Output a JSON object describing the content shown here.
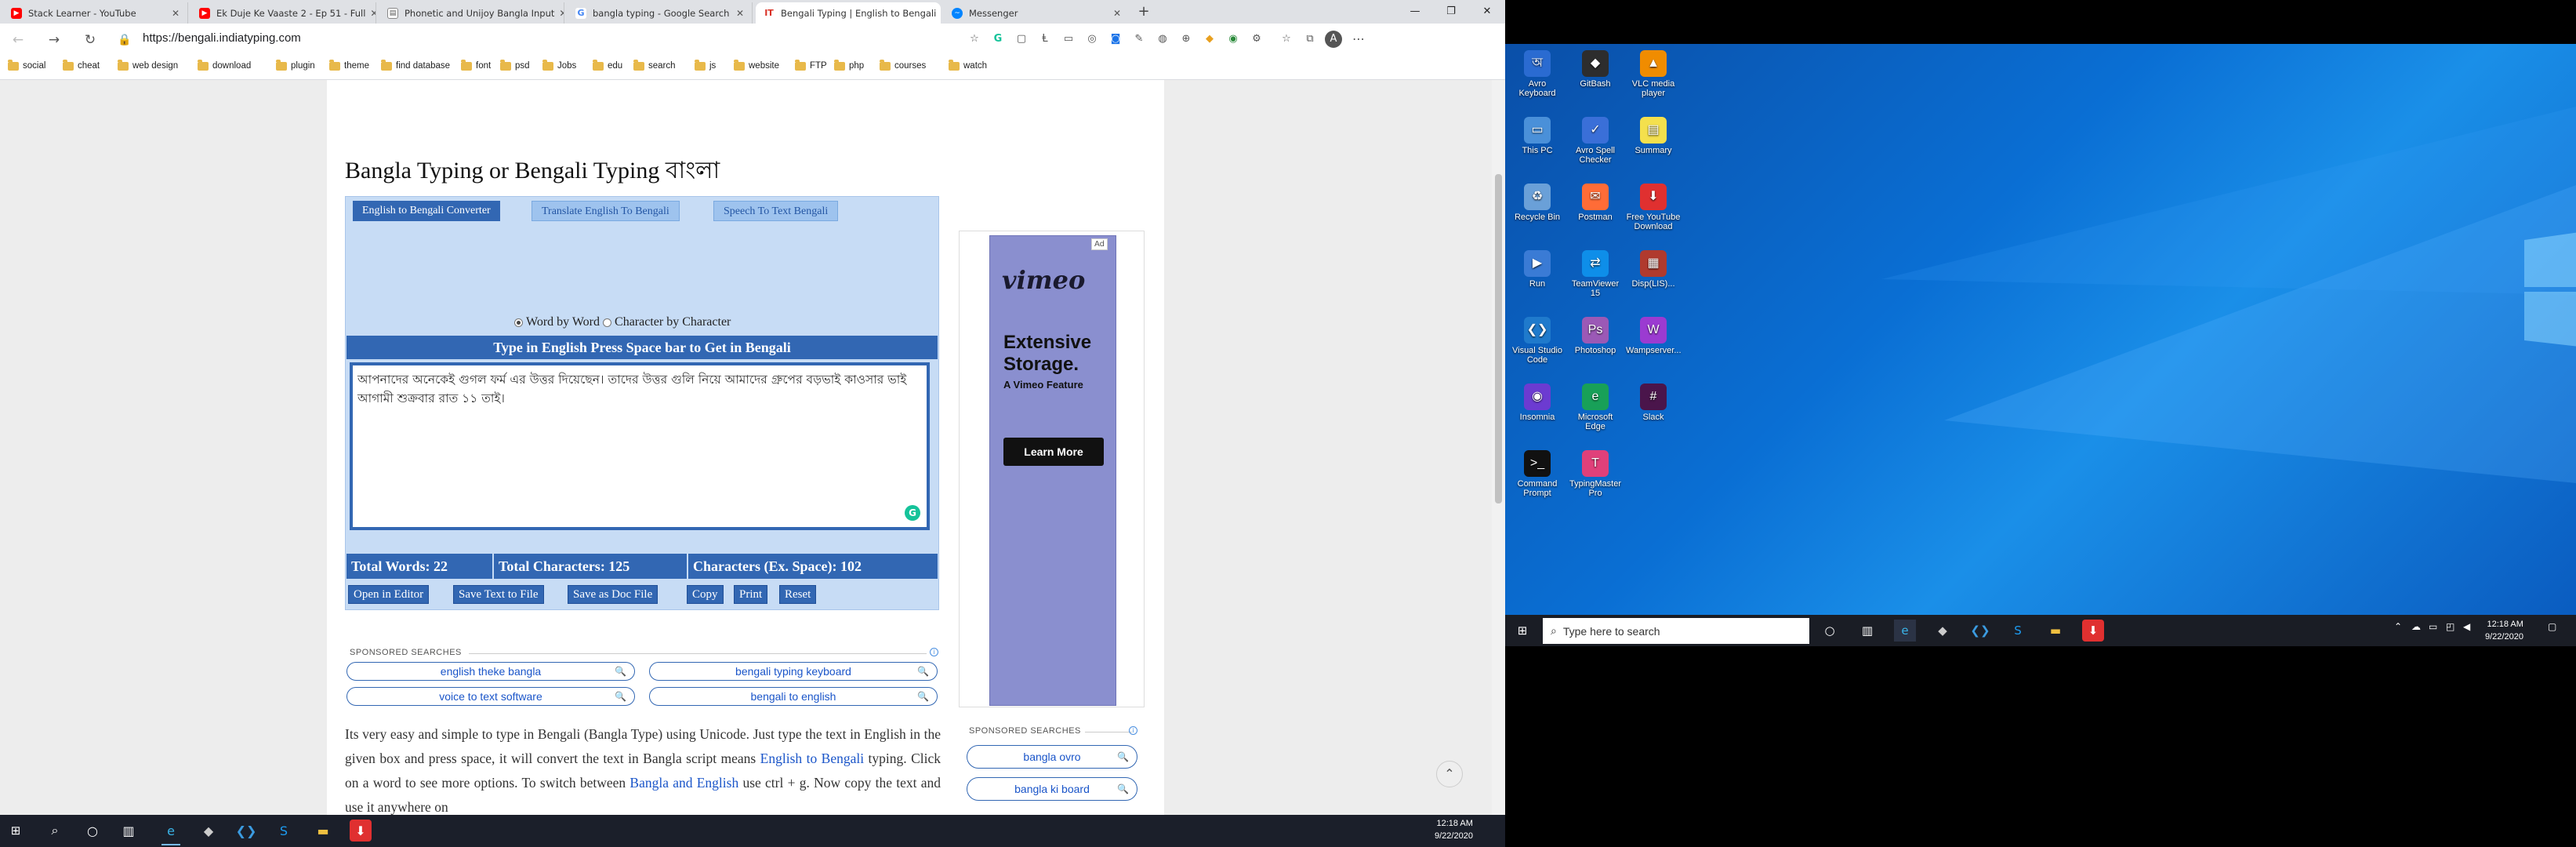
{
  "browser": {
    "tabs": [
      {
        "label": "Stack Learner - YouTube",
        "color": "#ff0000"
      },
      {
        "label": "Ek Duje Ke Vaaste 2 - Ep 51 - Full",
        "color": "#ff0000"
      },
      {
        "label": "Phonetic and Unijoy Bangla Input",
        "color": "#888888"
      },
      {
        "label": "bangla typing - Google Search",
        "color": "#4285f4"
      },
      {
        "label": "Bengali Typing | English to Bengali",
        "color": "#d93025"
      },
      {
        "label": "Messenger",
        "color": "#0084ff"
      }
    ],
    "url": "https://bengali.indiatyping.com",
    "bookmarks": [
      "social",
      "cheat",
      "web design",
      "download",
      "plugin",
      "theme",
      "find database",
      "font",
      "psd",
      "Jobs",
      "edu",
      "search",
      "js",
      "website",
      "FTP",
      "php",
      "courses",
      "watch"
    ]
  },
  "page": {
    "title": "Bangla Typing or Bengali Typing বাংলা",
    "tabs": [
      "English to Bengali Converter",
      "Translate English To Bengali",
      "Speech To Text Bengali"
    ],
    "mode": {
      "word": "Word by Word",
      "char": "Character by Character"
    },
    "instruction": "Type in English Press Space bar to Get in Bengali",
    "text": "আপনাদের অনেকেই গুগল ফর্ম এর উত্তর দিয়েছেন। তাদের উত্তর গুলি নিয়ে আমাদের গ্রুপের বড়ভাই কাওসার ভাই আগামী শুক্রবার রাত ১১ তাই।",
    "stats": {
      "words": "Total Words: 22",
      "chars": "Total Characters: 125",
      "chars_ex": "Characters (Ex. Space): 102"
    },
    "buttons": [
      "Open in Editor",
      "Save Text to File",
      "Save as Doc File",
      "Copy",
      "Print",
      "Reset"
    ],
    "sponsored_label": "SPONSORED SEARCHES",
    "sponsored": [
      "english theke bangla",
      "bengali typing keyboard",
      "voice to text software",
      "bengali to english"
    ],
    "side_sponsored": [
      "bangla ovro",
      "bangla ki board"
    ],
    "paragraph": {
      "p1": "Its very easy and simple to type in Bengali (Bangla Type) using Unicode. Just type the text in English in the given box and press space, it will convert the text in Bangla script means ",
      "link1": "English to Bengali",
      "p2": " typing. Click on a word to see more options. To switch between ",
      "link2": "Bangla and English",
      "p3": " use ctrl + g. Now copy the text and use it anywhere on"
    },
    "ad": {
      "tag": "Ad",
      "brand": "vimeo",
      "headline1": "Extensive",
      "headline2": "Storage.",
      "sub": "A Vimeo Feature",
      "cta": "Learn More"
    }
  },
  "taskbar_left": {
    "time": "12:18 AM",
    "date": "9/22/2020"
  },
  "desktop": {
    "icons": [
      {
        "label": "Avro Keyboard",
        "color": "#2a6bd1",
        "glyph": "অ"
      },
      {
        "label": "GitBash",
        "color": "#2d2d2d",
        "glyph": "◆"
      },
      {
        "label": "VLC media player",
        "color": "#f08c00",
        "glyph": "▲"
      },
      {
        "label": "This PC",
        "color": "#4a90d9",
        "glyph": "▭"
      },
      {
        "label": "Avro Spell Checker",
        "color": "#3a6fd8",
        "glyph": "✓"
      },
      {
        "label": "Summary",
        "color": "#f4e04d",
        "glyph": "▤"
      },
      {
        "label": "Recycle Bin",
        "color": "#6aa0d8",
        "glyph": "♻"
      },
      {
        "label": "Postman",
        "color": "#ff6c37",
        "glyph": "✉"
      },
      {
        "label": "Free YouTube Download",
        "color": "#e03030",
        "glyph": "⬇"
      },
      {
        "label": "Run",
        "color": "#3a7bd5",
        "glyph": "▶"
      },
      {
        "label": "TeamViewer 15",
        "color": "#0e8ee9",
        "glyph": "⇄"
      },
      {
        "label": "Disp(LIS)...",
        "color": "#b03a2e",
        "glyph": "▦"
      },
      {
        "label": "Visual Studio Code",
        "color": "#1f7acc",
        "glyph": "❮❯"
      },
      {
        "label": "Photoshop",
        "color": "#9b59b6",
        "glyph": "Ps"
      },
      {
        "label": "Wampserver...",
        "color": "#9b3bd1",
        "glyph": "W"
      },
      {
        "label": "Insomnia",
        "color": "#6c3bd1",
        "glyph": "◉"
      },
      {
        "label": "Microsoft Edge",
        "color": "#18a058",
        "glyph": "e"
      },
      {
        "label": "Slack",
        "color": "#4a154b",
        "glyph": "#"
      },
      {
        "label": "Command Prompt",
        "color": "#111111",
        "glyph": ">_"
      },
      {
        "label": "TypingMaster Pro",
        "color": "#e0407a",
        "glyph": "T"
      }
    ],
    "search_placeholder": "Type here to search",
    "time": "12:18 AM",
    "date": "9/22/2020"
  }
}
